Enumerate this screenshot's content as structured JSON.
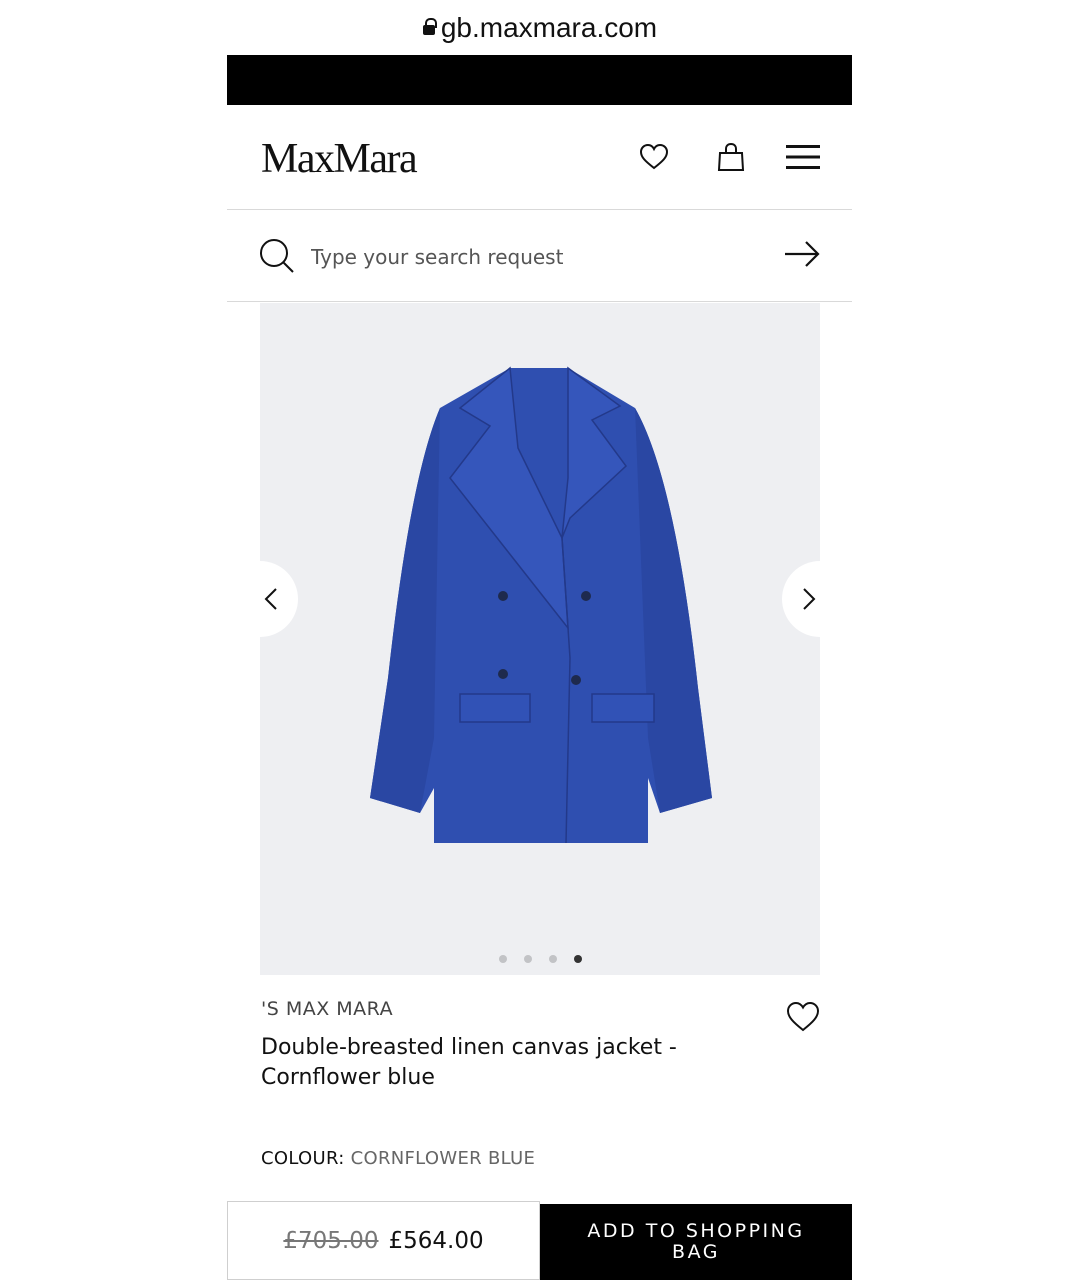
{
  "browser": {
    "url": "gb.maxmara.com",
    "lock_icon": "lock-icon"
  },
  "header": {
    "logo": "MaxMara",
    "icons": [
      "heart-icon",
      "shopping-bag-icon",
      "menu-icon"
    ]
  },
  "search": {
    "placeholder": "Type your search request",
    "value": ""
  },
  "gallery": {
    "image_count": 4,
    "active_index": 4,
    "product_color_hex": "#2f4fb0",
    "background_hex": "#eeeff2"
  },
  "product": {
    "brand": "'S MAX MARA",
    "name": "Double-breasted linen canvas jacket - Cornflower blue",
    "colour_label": "COLOUR:",
    "colour_value": "CORNFLOWER BLUE"
  },
  "purchase": {
    "old_price": "£705.00",
    "price": "£564.00",
    "button_label": "ADD TO SHOPPING BAG"
  }
}
